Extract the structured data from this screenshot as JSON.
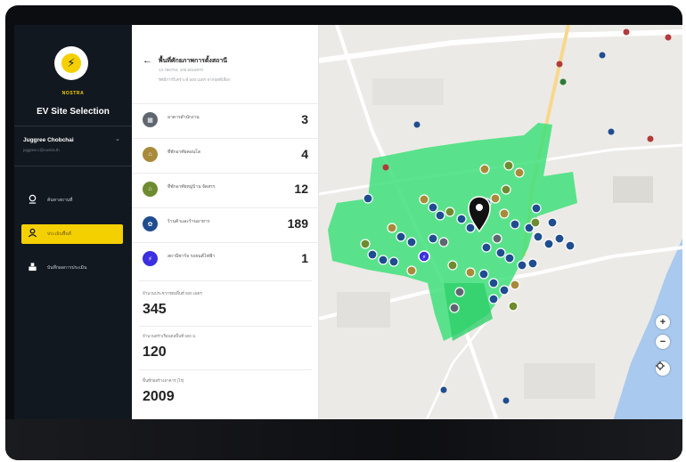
{
  "app": {
    "brand": "NOSTRA",
    "title": "EV Site Selection",
    "logo_icon": "bolt-icon"
  },
  "user": {
    "name": "Juggree Chobchai",
    "email": "juggree.c@nostra.th"
  },
  "nav": [
    {
      "icon": "search-location-icon",
      "label": "ค้นหาสถานที่",
      "active": false
    },
    {
      "icon": "location-user-icon",
      "label": "ประเมินพื้นที่",
      "active": true
    },
    {
      "icon": "report-icon",
      "label": "บันทึกผลการประเมิน",
      "active": false
    }
  ],
  "panel": {
    "title": "พื้นที่ศักยภาพการตั้งสถานี",
    "subtitle1": "13.766704, 100.5016970",
    "subtitle2": "รัศมีการวิเคราะห์ 500 เมตร จากจุดที่เลือก",
    "rows": [
      {
        "icon": "building-icon",
        "label": "อาคารสำนักงาน",
        "value": "3",
        "color": "#5f6670"
      },
      {
        "icon": "store-icon",
        "label": "ที่พักอาศัยคอนโด",
        "value": "4",
        "color": "#a88a3a"
      },
      {
        "icon": "house-icon",
        "label": "ที่พักอาศัยหมู่บ้าน จัดสรร",
        "value": "12",
        "color": "#6e8b2f"
      },
      {
        "icon": "shop-icon",
        "label": "ร้านค้าและร้านอาหาร",
        "value": "189",
        "color": "#1f4d8f"
      },
      {
        "icon": "charging-icon",
        "label": "สถานีชาร์จ รถยนต์ไฟฟ้า",
        "value": "1",
        "color": "#3b2fe0"
      }
    ],
    "metrics": [
      {
        "label": "จำนวนประชากรต่อพื้นที่ 500 เมตร",
        "value": "345"
      },
      {
        "label": "จำนวนครัวเรือนต่อพื้นที่ 500 ม.",
        "value": "120"
      },
      {
        "label": "พื้นที่ก่อสร้างอาคาร (ไร่)",
        "value": "2009"
      }
    ]
  },
  "map": {
    "zoom_in": "+",
    "zoom_out": "−",
    "locate_icon": "crosshair-icon",
    "zone_color": "#3fe07a",
    "marker_icon": "map-pin-icon"
  }
}
